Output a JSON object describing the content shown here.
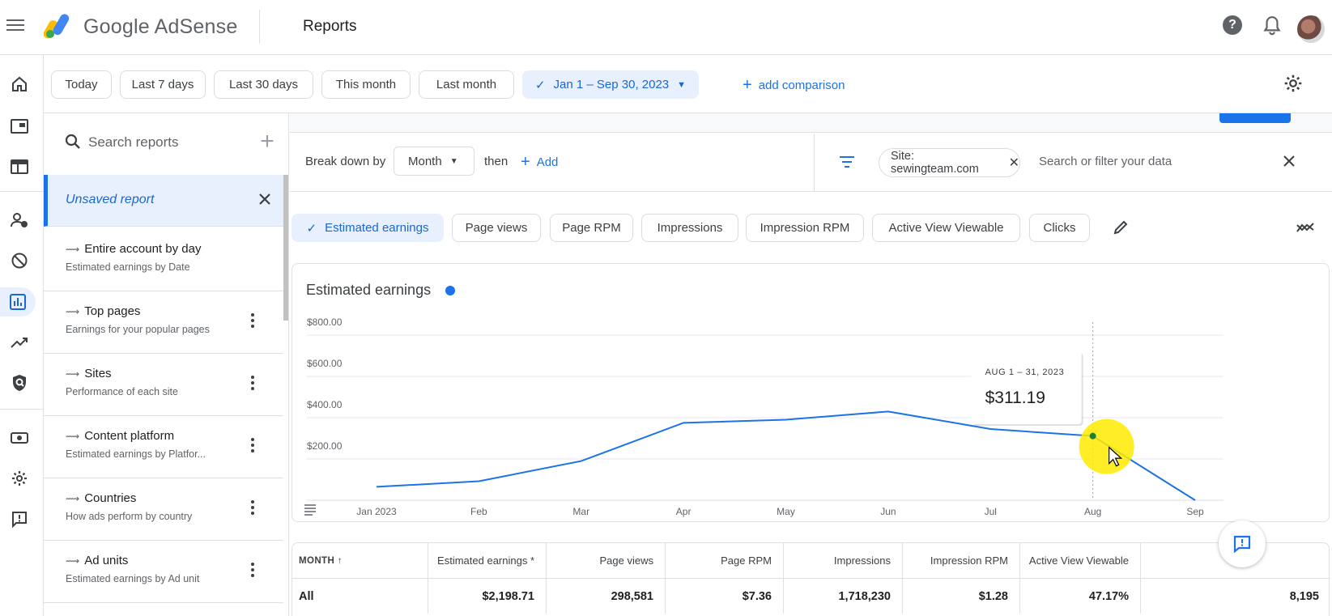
{
  "header": {
    "brand": "Google AdSense",
    "title": "Reports"
  },
  "date_filters": {
    "chips": [
      "Today",
      "Last 7 days",
      "Last 30 days",
      "This month",
      "Last month"
    ],
    "selected_range": "Jan 1 – Sep 30, 2023",
    "add_comparison": "add comparison"
  },
  "sidebar": {
    "search_placeholder": "Search reports",
    "unsaved_report": "Unsaved report",
    "reports": [
      {
        "title": "Entire account by day",
        "subtitle": "Estimated earnings by Date"
      },
      {
        "title": "Top pages",
        "subtitle": "Earnings for your popular pages"
      },
      {
        "title": "Sites",
        "subtitle": "Performance of each site"
      },
      {
        "title": "Content platform",
        "subtitle": "Estimated earnings by Platfor..."
      },
      {
        "title": "Countries",
        "subtitle": "How ads perform by country"
      },
      {
        "title": "Ad units",
        "subtitle": "Estimated earnings by Ad unit"
      }
    ]
  },
  "breakdown": {
    "label": "Break down by",
    "dimension": "Month",
    "then": "then",
    "add": "Add"
  },
  "filter": {
    "site_chip": "Site: sewingteam.com",
    "search_placeholder": "Search or filter your data"
  },
  "metrics": [
    "Estimated earnings",
    "Page views",
    "Page RPM",
    "Impressions",
    "Impression RPM",
    "Active View Viewable",
    "Clicks"
  ],
  "chart_data": {
    "type": "line",
    "title": "Estimated earnings",
    "categories": [
      "Jan 2023",
      "Feb",
      "Mar",
      "Apr",
      "May",
      "Jun",
      "Jul",
      "Aug",
      "Sep"
    ],
    "series": [
      {
        "name": "Estimated earnings",
        "values": [
          65,
          92,
          190,
          375,
          390,
          430,
          345,
          311.19,
          0
        ]
      }
    ],
    "y_ticks": [
      "$800.00",
      "$600.00",
      "$400.00",
      "$200.00"
    ],
    "ylim": [
      0,
      800
    ],
    "grid": true,
    "tooltip": {
      "label": "AUG 1 – 31, 2023",
      "value": "$311.19",
      "index": 7
    }
  },
  "table": {
    "headers": [
      "MONTH",
      "Estimated earnings *",
      "Page views",
      "Page RPM",
      "Impressions",
      "Impression RPM",
      "Active View Viewable",
      ""
    ],
    "total_row": [
      "All",
      "$2,198.71",
      "298,581",
      "$7.36",
      "1,718,230",
      "$1.28",
      "47.17%",
      "8,195"
    ]
  },
  "colors": {
    "accent": "#1a73e8",
    "selected_bg": "#e8f0fe",
    "line": "#1a73e8"
  }
}
